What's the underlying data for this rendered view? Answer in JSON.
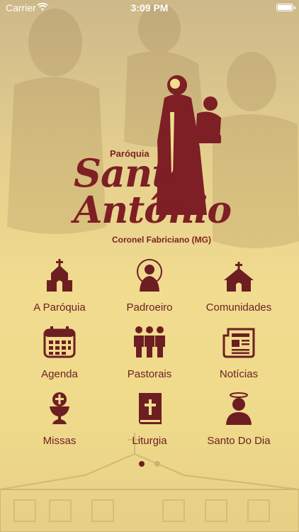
{
  "status_bar": {
    "carrier": "Carrier",
    "time": "3:09 PM"
  },
  "logo": {
    "line1": "Paróquia",
    "line2": "Santo",
    "line3": "Antônio",
    "line4": "Coronel Fabriciano (MG)"
  },
  "menu": [
    {
      "label": "A Paróquia",
      "icon": "chapel-icon"
    },
    {
      "label": "Padroeiro",
      "icon": "patron-saint-icon"
    },
    {
      "label": "Comunidades",
      "icon": "church-icon"
    },
    {
      "label": "Agenda",
      "icon": "calendar-icon"
    },
    {
      "label": "Pastorais",
      "icon": "group-icon"
    },
    {
      "label": "Notícias",
      "icon": "newspaper-icon"
    },
    {
      "label": "Missas",
      "icon": "chalice-icon"
    },
    {
      "label": "Liturgia",
      "icon": "bible-icon"
    },
    {
      "label": "Santo Do Dia",
      "icon": "saint-halo-icon"
    }
  ],
  "pager": {
    "pages": 2,
    "active_index": 0
  },
  "colors": {
    "brand": "#6d1e22",
    "background": "#f1dc8f"
  }
}
